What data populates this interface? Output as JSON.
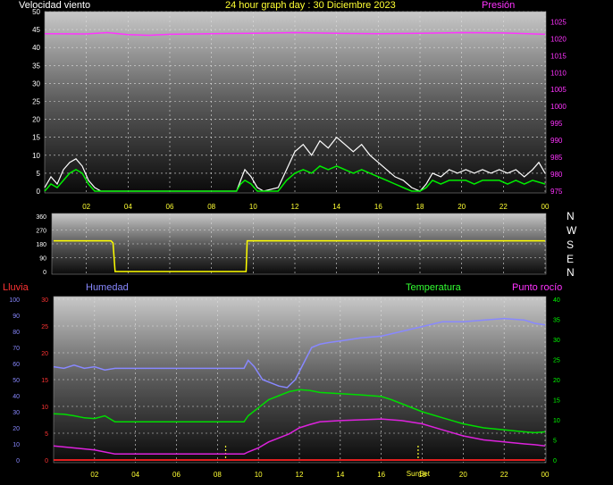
{
  "header": {
    "wind_label": "Velocidad viento",
    "title": "24 hour graph day : 30 Diciembre 2023",
    "pressure_label": "Presión"
  },
  "lower_header": {
    "rain_label": "Lluvia",
    "humidity_label": "Humedad",
    "temperature_label": "Temperatura",
    "dewpoint_label": "Punto rocío"
  },
  "compass": [
    "N",
    "W",
    "S",
    "E",
    "N"
  ],
  "sun_label": "SunSet",
  "colors": {
    "wind_gust": "#ffffff",
    "wind_avg": "#00ee00",
    "pressure": "#ff33ff",
    "direction": "#ffff00",
    "humidity": "#8888ff",
    "temperature": "#00dd00",
    "dewpoint": "#dd22dd",
    "rain": "#ff2222",
    "left_axis": "#ffffff",
    "temp_axis": "#00ff00",
    "rain_axis": "#ff3333",
    "hum_axis": "#8888ff"
  },
  "chart_data": [
    {
      "type": "line",
      "name": "wind-pressure",
      "x_ticks": [
        "02",
        "04",
        "06",
        "08",
        "10",
        "12",
        "14",
        "16",
        "18",
        "20",
        "22",
        "00"
      ],
      "y_left_ticks": [
        0,
        5,
        10,
        15,
        20,
        25,
        30,
        35,
        40,
        45,
        50
      ],
      "y_left_range": [
        0,
        50
      ],
      "y_right_ticks": [
        975,
        980,
        985,
        990,
        995,
        1000,
        1005,
        1010,
        1015,
        1020,
        1025
      ],
      "y_right_range": [
        975,
        1028
      ],
      "series": [
        {
          "name": "gust",
          "axis": "left",
          "points": [
            [
              0,
              1
            ],
            [
              0.3,
              4
            ],
            [
              0.6,
              2
            ],
            [
              0.9,
              6
            ],
            [
              1.2,
              8
            ],
            [
              1.5,
              9
            ],
            [
              1.8,
              7
            ],
            [
              2.1,
              3
            ],
            [
              2.4,
              1
            ],
            [
              2.7,
              0
            ],
            [
              3,
              0
            ],
            [
              9.2,
              0
            ],
            [
              9.4,
              3
            ],
            [
              9.6,
              6
            ],
            [
              9.9,
              4
            ],
            [
              10.2,
              1
            ],
            [
              10.5,
              0
            ],
            [
              11.2,
              1
            ],
            [
              11.6,
              6
            ],
            [
              12,
              11
            ],
            [
              12.4,
              13
            ],
            [
              12.8,
              10
            ],
            [
              13.2,
              14
            ],
            [
              13.6,
              12
            ],
            [
              14,
              15
            ],
            [
              14.4,
              13
            ],
            [
              14.8,
              11
            ],
            [
              15.2,
              13
            ],
            [
              15.6,
              10
            ],
            [
              16,
              8
            ],
            [
              16.4,
              6
            ],
            [
              16.8,
              4
            ],
            [
              17.2,
              3
            ],
            [
              17.6,
              1
            ],
            [
              18,
              0
            ],
            [
              18.3,
              2
            ],
            [
              18.6,
              5
            ],
            [
              19,
              4
            ],
            [
              19.4,
              6
            ],
            [
              19.8,
              5
            ],
            [
              20.2,
              6
            ],
            [
              20.6,
              5
            ],
            [
              21,
              6
            ],
            [
              21.4,
              5
            ],
            [
              21.8,
              6
            ],
            [
              22.2,
              5
            ],
            [
              22.6,
              6
            ],
            [
              23,
              4
            ],
            [
              23.4,
              6
            ],
            [
              23.7,
              8
            ],
            [
              24,
              5
            ]
          ]
        },
        {
          "name": "average",
          "axis": "left",
          "points": [
            [
              0,
              0
            ],
            [
              0.3,
              2
            ],
            [
              0.6,
              1
            ],
            [
              0.9,
              3
            ],
            [
              1.2,
              5
            ],
            [
              1.5,
              6
            ],
            [
              1.8,
              5
            ],
            [
              2.1,
              2
            ],
            [
              2.4,
              0
            ],
            [
              9.2,
              0
            ],
            [
              9.4,
              2
            ],
            [
              9.6,
              3
            ],
            [
              9.9,
              2
            ],
            [
              10.2,
              0
            ],
            [
              11.2,
              0
            ],
            [
              11.6,
              3
            ],
            [
              12,
              5
            ],
            [
              12.4,
              6
            ],
            [
              12.8,
              5
            ],
            [
              13.2,
              7
            ],
            [
              13.6,
              6
            ],
            [
              14,
              7
            ],
            [
              14.4,
              6
            ],
            [
              14.8,
              5
            ],
            [
              15.2,
              6
            ],
            [
              15.6,
              5
            ],
            [
              16,
              4
            ],
            [
              16.4,
              3
            ],
            [
              16.8,
              2
            ],
            [
              17.2,
              1
            ],
            [
              17.6,
              0
            ],
            [
              18,
              0
            ],
            [
              18.3,
              1
            ],
            [
              18.6,
              3
            ],
            [
              19,
              2
            ],
            [
              19.4,
              3
            ],
            [
              19.8,
              3
            ],
            [
              20.2,
              3
            ],
            [
              20.6,
              2
            ],
            [
              21,
              3
            ],
            [
              21.4,
              3
            ],
            [
              21.8,
              3
            ],
            [
              22.2,
              2
            ],
            [
              22.6,
              3
            ],
            [
              23,
              2
            ],
            [
              23.4,
              3
            ],
            [
              24,
              2
            ]
          ]
        },
        {
          "name": "pressure",
          "axis": "right",
          "points": [
            [
              0,
              1021.5
            ],
            [
              2,
              1021.4
            ],
            [
              3,
              1021.8
            ],
            [
              4,
              1021.2
            ],
            [
              5,
              1021
            ],
            [
              6,
              1021.3
            ],
            [
              8,
              1021.5
            ],
            [
              10,
              1021.6
            ],
            [
              12,
              1021.8
            ],
            [
              14,
              1021.6
            ],
            [
              16,
              1021.5
            ],
            [
              18,
              1021.6
            ],
            [
              20,
              1021.8
            ],
            [
              22,
              1021.7
            ],
            [
              23.5,
              1021.4
            ],
            [
              24,
              1021.3
            ]
          ]
        }
      ]
    },
    {
      "type": "line",
      "name": "wind-direction",
      "y_ticks": [
        0,
        90,
        180,
        270,
        360
      ],
      "y_range": [
        0,
        360
      ],
      "series": [
        {
          "name": "direction",
          "points": [
            [
              0,
              200
            ],
            [
              2.8,
              200
            ],
            [
              2.9,
              185
            ],
            [
              3,
              0
            ],
            [
              9.4,
              0
            ],
            [
              9.45,
              200
            ],
            [
              24,
              200
            ]
          ]
        }
      ]
    },
    {
      "type": "line",
      "name": "temp-humidity-rain",
      "x_ticks": [
        "02",
        "04",
        "06",
        "08",
        "10",
        "12",
        "14",
        "16",
        "18",
        "20",
        "22",
        "00"
      ],
      "y_rain_ticks": [
        0,
        5,
        10,
        15,
        20,
        25,
        30
      ],
      "y_rain_range": [
        0,
        30
      ],
      "y_hum_ticks": [
        0,
        10,
        20,
        30,
        40,
        50,
        60,
        70,
        80,
        90,
        100
      ],
      "y_hum_range": [
        0,
        100
      ],
      "y_temp_ticks": [
        0,
        5,
        10,
        15,
        20,
        25,
        30,
        35,
        40
      ],
      "y_temp_range": [
        0,
        40
      ],
      "markers": [
        8.4,
        17.8
      ],
      "series": [
        {
          "name": "humidity",
          "axis": "hum",
          "points": [
            [
              0,
              58
            ],
            [
              0.5,
              57
            ],
            [
              1,
              59
            ],
            [
              1.5,
              57
            ],
            [
              2,
              58
            ],
            [
              2.5,
              56
            ],
            [
              3,
              57
            ],
            [
              9.3,
              57
            ],
            [
              9.5,
              62
            ],
            [
              9.8,
              58
            ],
            [
              10.2,
              50
            ],
            [
              10.6,
              48
            ],
            [
              11,
              46
            ],
            [
              11.4,
              45
            ],
            [
              11.8,
              50
            ],
            [
              12.2,
              60
            ],
            [
              12.6,
              70
            ],
            [
              13,
              72
            ],
            [
              13.4,
              73
            ],
            [
              14,
              74
            ],
            [
              15,
              76
            ],
            [
              16,
              77
            ],
            [
              17,
              80
            ],
            [
              18,
              83
            ],
            [
              19,
              86
            ],
            [
              20,
              86
            ],
            [
              21,
              87
            ],
            [
              22,
              88
            ],
            [
              23,
              87
            ],
            [
              23.5,
              85
            ],
            [
              24,
              84
            ]
          ]
        },
        {
          "name": "temperature",
          "axis": "temp",
          "points": [
            [
              0,
              11.5
            ],
            [
              0.5,
              11.4
            ],
            [
              1,
              11
            ],
            [
              1.5,
              10.5
            ],
            [
              2,
              10.3
            ],
            [
              2.5,
              11
            ],
            [
              3,
              9.5
            ],
            [
              9.3,
              9.5
            ],
            [
              9.5,
              11
            ],
            [
              10,
              13
            ],
            [
              10.5,
              15
            ],
            [
              11,
              16
            ],
            [
              11.5,
              17
            ],
            [
              12,
              17.5
            ],
            [
              12.5,
              17.3
            ],
            [
              13,
              16.8
            ],
            [
              14,
              16.5
            ],
            [
              15,
              16.2
            ],
            [
              16,
              15.8
            ],
            [
              16.5,
              15
            ],
            [
              17,
              14
            ],
            [
              18,
              12
            ],
            [
              19,
              10.5
            ],
            [
              20,
              9
            ],
            [
              21,
              8
            ],
            [
              22,
              7.5
            ],
            [
              23,
              7
            ],
            [
              23.5,
              6.8
            ],
            [
              24,
              7
            ]
          ]
        },
        {
          "name": "dewpoint",
          "axis": "temp",
          "points": [
            [
              0,
              3.5
            ],
            [
              1,
              3
            ],
            [
              2,
              2.5
            ],
            [
              3,
              1.5
            ],
            [
              9.3,
              1.5
            ],
            [
              9.5,
              2
            ],
            [
              10,
              3
            ],
            [
              10.5,
              4.5
            ],
            [
              11,
              5.5
            ],
            [
              11.5,
              6.5
            ],
            [
              12,
              8
            ],
            [
              12.5,
              8.8
            ],
            [
              13,
              9.5
            ],
            [
              14,
              9.8
            ],
            [
              15,
              10
            ],
            [
              16,
              10.2
            ],
            [
              17,
              9.8
            ],
            [
              18,
              9
            ],
            [
              19,
              7.5
            ],
            [
              20,
              6
            ],
            [
              21,
              5
            ],
            [
              22,
              4.5
            ],
            [
              23,
              4
            ],
            [
              23.5,
              3.8
            ],
            [
              24,
              3.5
            ]
          ]
        },
        {
          "name": "rain",
          "axis": "rain",
          "points": [
            [
              0,
              0
            ],
            [
              24,
              0
            ]
          ]
        }
      ]
    }
  ]
}
